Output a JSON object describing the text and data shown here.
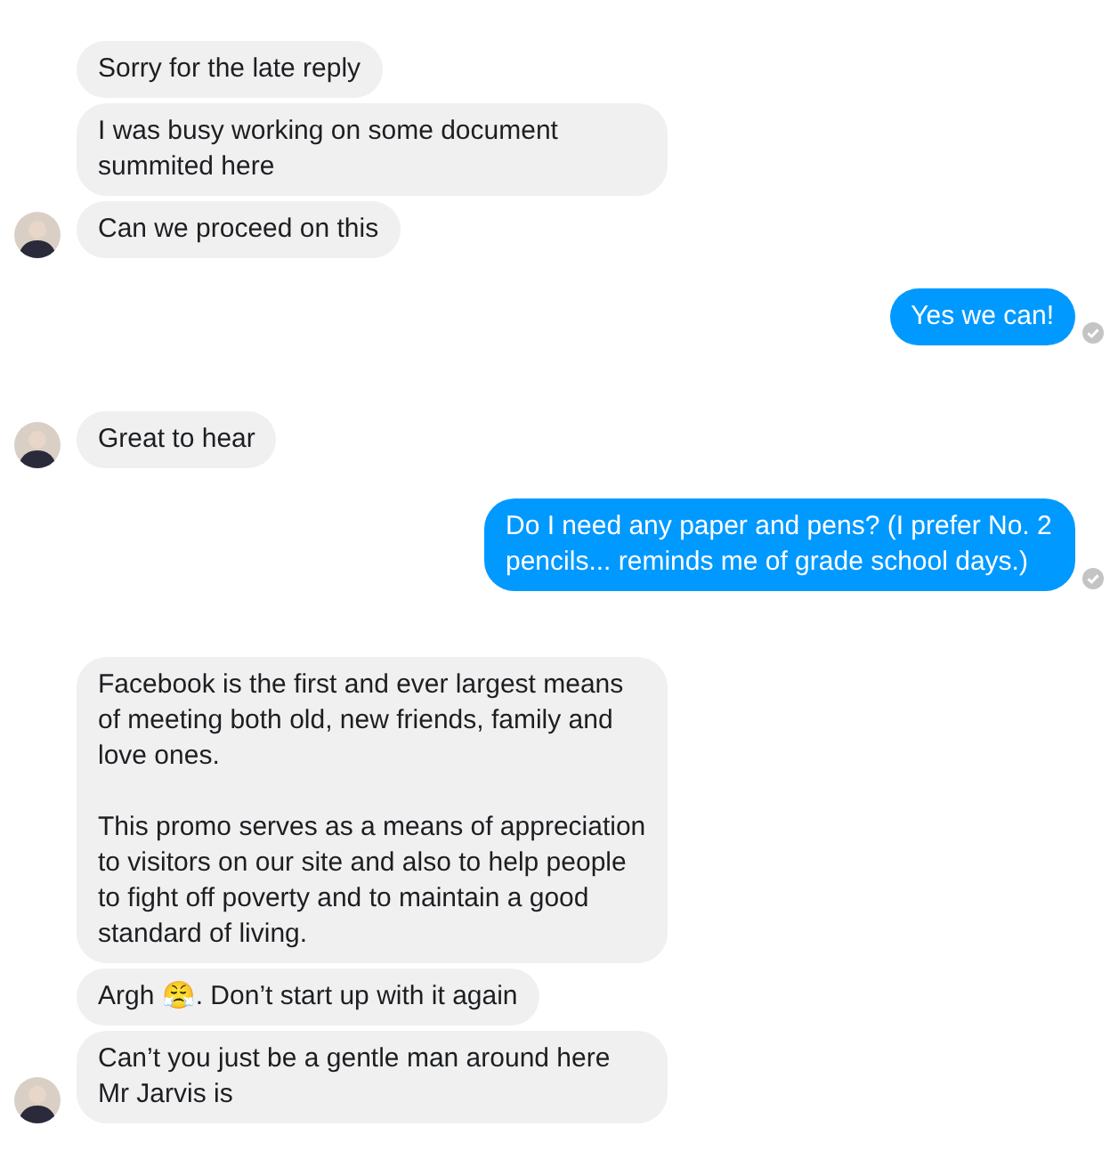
{
  "groups": [
    {
      "kind": "incoming",
      "messages": [
        "Sorry for the late reply",
        "I was busy working on some document summited here",
        "Can we proceed on this"
      ]
    },
    {
      "kind": "outgoing",
      "messages": [
        "Yes we can!"
      ]
    },
    {
      "kind": "incoming",
      "messages": [
        "Great to hear"
      ]
    },
    {
      "kind": "outgoing",
      "messages": [
        "Do I need any paper and pens? (I prefer No. 2 pencils... reminds me of grade school days.)"
      ]
    },
    {
      "kind": "incoming",
      "messages": [
        "Facebook is the first and ever largest means of meeting both old, new friends, family and love ones.\n\nThis promo  serves as a means of appreciation to visitors on our site and also to help people to fight off poverty and to maintain a good standard of living.",
        "Argh 😤. Don’t start up with it again",
        "Can’t you just be a gentle man around here Mr Jarvis is"
      ]
    }
  ]
}
